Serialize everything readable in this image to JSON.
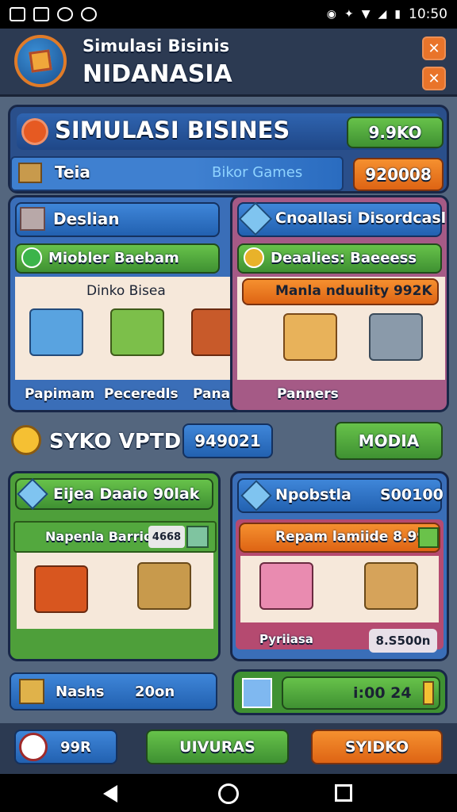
{
  "status_bar": {
    "time": "10:50"
  },
  "header": {
    "subtitle": "Simulasi Bisinis",
    "title": "NIDANASIA"
  },
  "title_bar": {
    "title": "SIMULASI BISINES",
    "value": "9.9KO"
  },
  "row2": {
    "label": "Teia",
    "center_text": "Bikor Games",
    "value": "920008"
  },
  "left_panel": {
    "header": "Deslian",
    "subheader": "Miobler Baebam",
    "caption": "Dinko Bisea",
    "items": [
      "Papimam",
      "Peceredls",
      "Panamak"
    ]
  },
  "right_panel": {
    "header": "Cnoallasi Disordcasl",
    "subheader": "Deaalies: Baeeess",
    "banner": "Manla nduulity 992K",
    "items": [
      "Panners"
    ]
  },
  "mid_row": {
    "label": "SYKO VPTD",
    "value": "949021",
    "button": "MODIA"
  },
  "bottom_left": {
    "header": "Eijea Daaio 90lak",
    "subheader": "Napenla Barride",
    "badge": "4668"
  },
  "bottom_right": {
    "header": "Npobstla",
    "value": "S00100",
    "subheader": "Repam lamiide 8.990",
    "caption": "Pyriiasa",
    "price": "8.S500n"
  },
  "footer_row": {
    "left_label": "Nashs",
    "left_value": "20on",
    "right_value": "i:00 24"
  },
  "bottom_bar": {
    "left": "99R",
    "middle": "UIVURAS",
    "right": "SYIDKO"
  },
  "colors": {
    "accent_orange": "#e9742a",
    "primary_blue": "#2e6fc4",
    "green": "#54ae3d"
  }
}
